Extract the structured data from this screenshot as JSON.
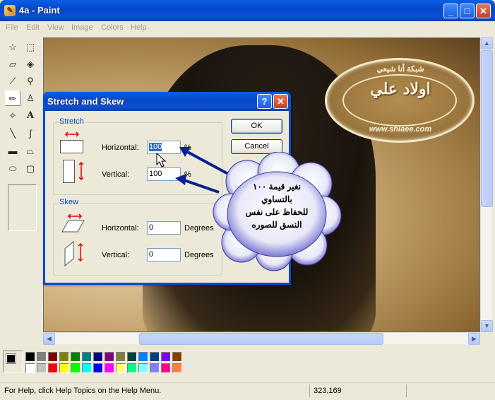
{
  "window": {
    "title": "4a - Paint",
    "app_icon": "paint-icon",
    "minimize": "_",
    "maximize": "□",
    "close": "✕"
  },
  "menu": [
    "File",
    "Edit",
    "View",
    "Image",
    "Colors",
    "Help"
  ],
  "emblem": {
    "top": "شبكة أنا شيعي",
    "title": "اولاد علي",
    "bottom": "www.shiaee.com"
  },
  "dialog": {
    "title": "Stretch and Skew",
    "help": "?",
    "close": "✕",
    "stretch": {
      "label": "Stretch",
      "horizontal_label": "Horizontal:",
      "horizontal_value": "100",
      "horizontal_unit": "%",
      "vertical_label": "Vertical:",
      "vertical_value": "100",
      "vertical_unit": "%"
    },
    "skew": {
      "label": "Skew",
      "horizontal_label": "Horizontal:",
      "horizontal_value": "0",
      "horizontal_unit": "Degrees",
      "vertical_label": "Vertical:",
      "vertical_value": "0",
      "vertical_unit": "Degrees"
    },
    "ok": "OK",
    "cancel": "Cancel"
  },
  "callout": {
    "line1": "نغير قيمة ١٠٠",
    "line2": "بالتساوي",
    "line3": "للحفاظ على نفس",
    "line4": "النسق للصوره"
  },
  "status": {
    "help": "For Help, click Help Topics on the Help Menu.",
    "coords": "323,169"
  },
  "palette": {
    "top_row": [
      "#000000",
      "#808080",
      "#800000",
      "#808000",
      "#008000",
      "#008080",
      "#000080",
      "#800080",
      "#808040",
      "#004040",
      "#0080ff",
      "#004080",
      "#8000ff",
      "#804000"
    ],
    "bottom_row": [
      "#ffffff",
      "#c0c0c0",
      "#ff0000",
      "#ffff00",
      "#00ff00",
      "#00ffff",
      "#0000ff",
      "#ff00ff",
      "#ffff80",
      "#00ff80",
      "#80ffff",
      "#8080ff",
      "#ff0080",
      "#ff8040"
    ]
  },
  "colors": {
    "accent": "#0846d8",
    "arrow": "#0a1f8f"
  }
}
